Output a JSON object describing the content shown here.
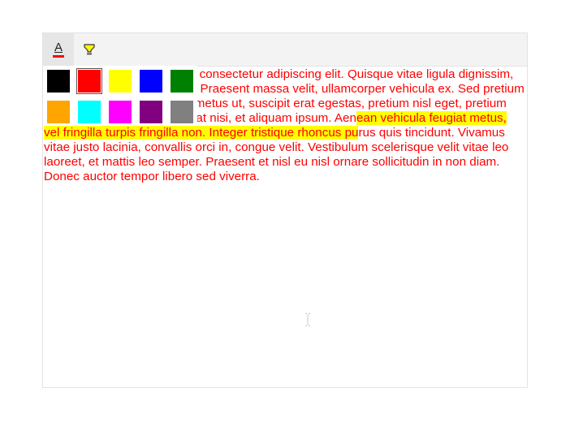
{
  "toolbar": {
    "font_color_button": {
      "icon": "font-color-icon",
      "glyph": "A",
      "underline_color": "#ff0000"
    },
    "highlight_button": {
      "icon": "highlighter-icon",
      "accent_color": "#ffff00"
    }
  },
  "palette": {
    "selected": "#ff0000",
    "colors": [
      "#000000",
      "#ff0000",
      "#ffff00",
      "#0000ff",
      "#008000",
      "#ffa500",
      "#00ffff",
      "#ff00ff",
      "#800080",
      "#808080"
    ]
  },
  "document": {
    "text_color": "#ff0000",
    "highlight_color": "#ffff00",
    "text_before_highlight": "Lorem ipsum dolor sit amet, consectetur adipiscing elit. Quisque vitae ligula dignissim, tristique nisi id, interdum ex. Praesent massa velit, ullamcorper vehicula ex. Sed pretium orci dapibus, condimentum metus ut, suscipit erat egestas, pretium nisl eget, pretium eros. Nullam sit amet volutpat nisi, et aliquam ipsum. Aen",
    "highlighted_text": "ean vehicula feugiat metus, vel fringilla turpis fringilla non. Integer tristique rhoncus pu",
    "text_after_highlight": "rus quis tincidunt. Vivamus vitae justo lacinia, convallis orci in, congue velit. Vestibulum scelerisque velit vitae leo laoreet, et mattis leo semper. Praesent et nisl eu nisl ornare sollicitudin in non diam. Donec auctor tempor libero sed viverra."
  }
}
